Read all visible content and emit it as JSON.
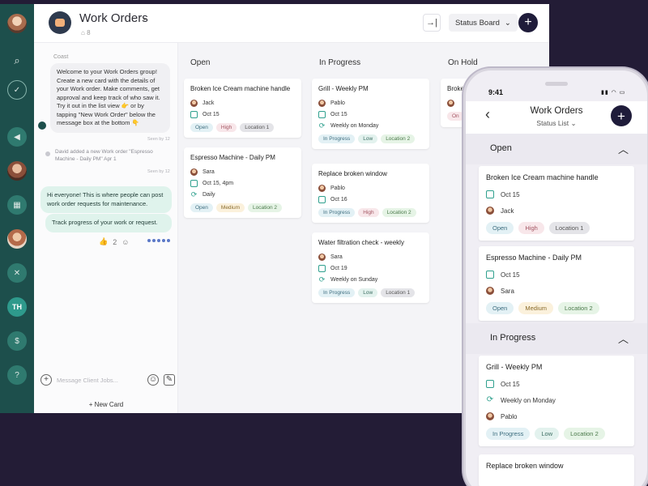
{
  "desktop": {
    "header": {
      "title": "Work Orders",
      "subtitle": "8",
      "view": "Status Board"
    },
    "rail": {
      "initials": "TH"
    },
    "chat": {
      "sender": "Coast",
      "welcome": "Welcome to your Work Orders group! Create a new card with the details of your Work order. Make comments, get approval and keep track of who saw it. Try it out in the list view 👉 or by tapping \"New Work Order\" below the message box at the bottom 👇",
      "welcome_time": "Seen by 12",
      "system": "David added a new Work order \"Espresso Machine - Daily PM\" Apr 1",
      "system_time": "Seen by 12",
      "msg1": "Hi everyone! This is where people can post work order requests for maintenance.",
      "msg2": "Track progress of your work or request.",
      "reaction_count": "2",
      "placeholder": "Message Client Jobs...",
      "new_card": "+ New Card"
    },
    "columns": [
      {
        "title": "Open",
        "cards": [
          {
            "title": "Broken Ice Cream machine handle",
            "assignee": "Jack",
            "date": "Oct 15",
            "tags": [
              "Open",
              "High",
              "Location 1"
            ]
          },
          {
            "title": "Espresso Machine - Daily PM",
            "assignee": "Sara",
            "date": "Oct 15, 4pm",
            "repeat": "Daily",
            "tags": [
              "Open",
              "Medium",
              "Location 2"
            ]
          }
        ]
      },
      {
        "title": "In Progress",
        "cards": [
          {
            "title": "Grill - Weekly PM",
            "assignee": "Pablo",
            "date": "Oct 15",
            "repeat": "Weekly on Monday",
            "tags": [
              "In Progress",
              "Low",
              "Location 2"
            ]
          },
          {
            "title": "Replace broken window",
            "assignee": "Pablo",
            "date": "Oct 16",
            "tags": [
              "In Progress",
              "High",
              "Location 2"
            ]
          },
          {
            "title": "Water filtration check - weekly",
            "assignee": "Sara",
            "date": "Oct 19",
            "repeat": "Weekly on Sunday",
            "tags": [
              "In Progress",
              "Low",
              "Location 1"
            ]
          }
        ]
      },
      {
        "title": "On Hold",
        "cards": [
          {
            "title": "Broke",
            "tags": [
              "On"
            ]
          }
        ]
      }
    ]
  },
  "phone": {
    "time": "9:41",
    "title": "Work Orders",
    "view": "Status List",
    "sections": [
      {
        "title": "Open",
        "cards": [
          {
            "title": "Broken Ice Cream machine handle",
            "date": "Oct 15",
            "assignee": "Jack",
            "tags": [
              "Open",
              "High",
              "Location 1"
            ]
          },
          {
            "title": "Espresso Machine - Daily PM",
            "date": "Oct 15",
            "assignee": "Sara",
            "tags": [
              "Open",
              "Medium",
              "Location 2"
            ]
          }
        ]
      },
      {
        "title": "In Progress",
        "cards": [
          {
            "title": "Grill - Weekly PM",
            "date": "Oct 15",
            "repeat": "Weekly on Monday",
            "assignee": "Pablo",
            "tags": [
              "In Progress",
              "Low",
              "Location 2"
            ]
          },
          {
            "title": "Replace broken window"
          }
        ]
      }
    ]
  }
}
